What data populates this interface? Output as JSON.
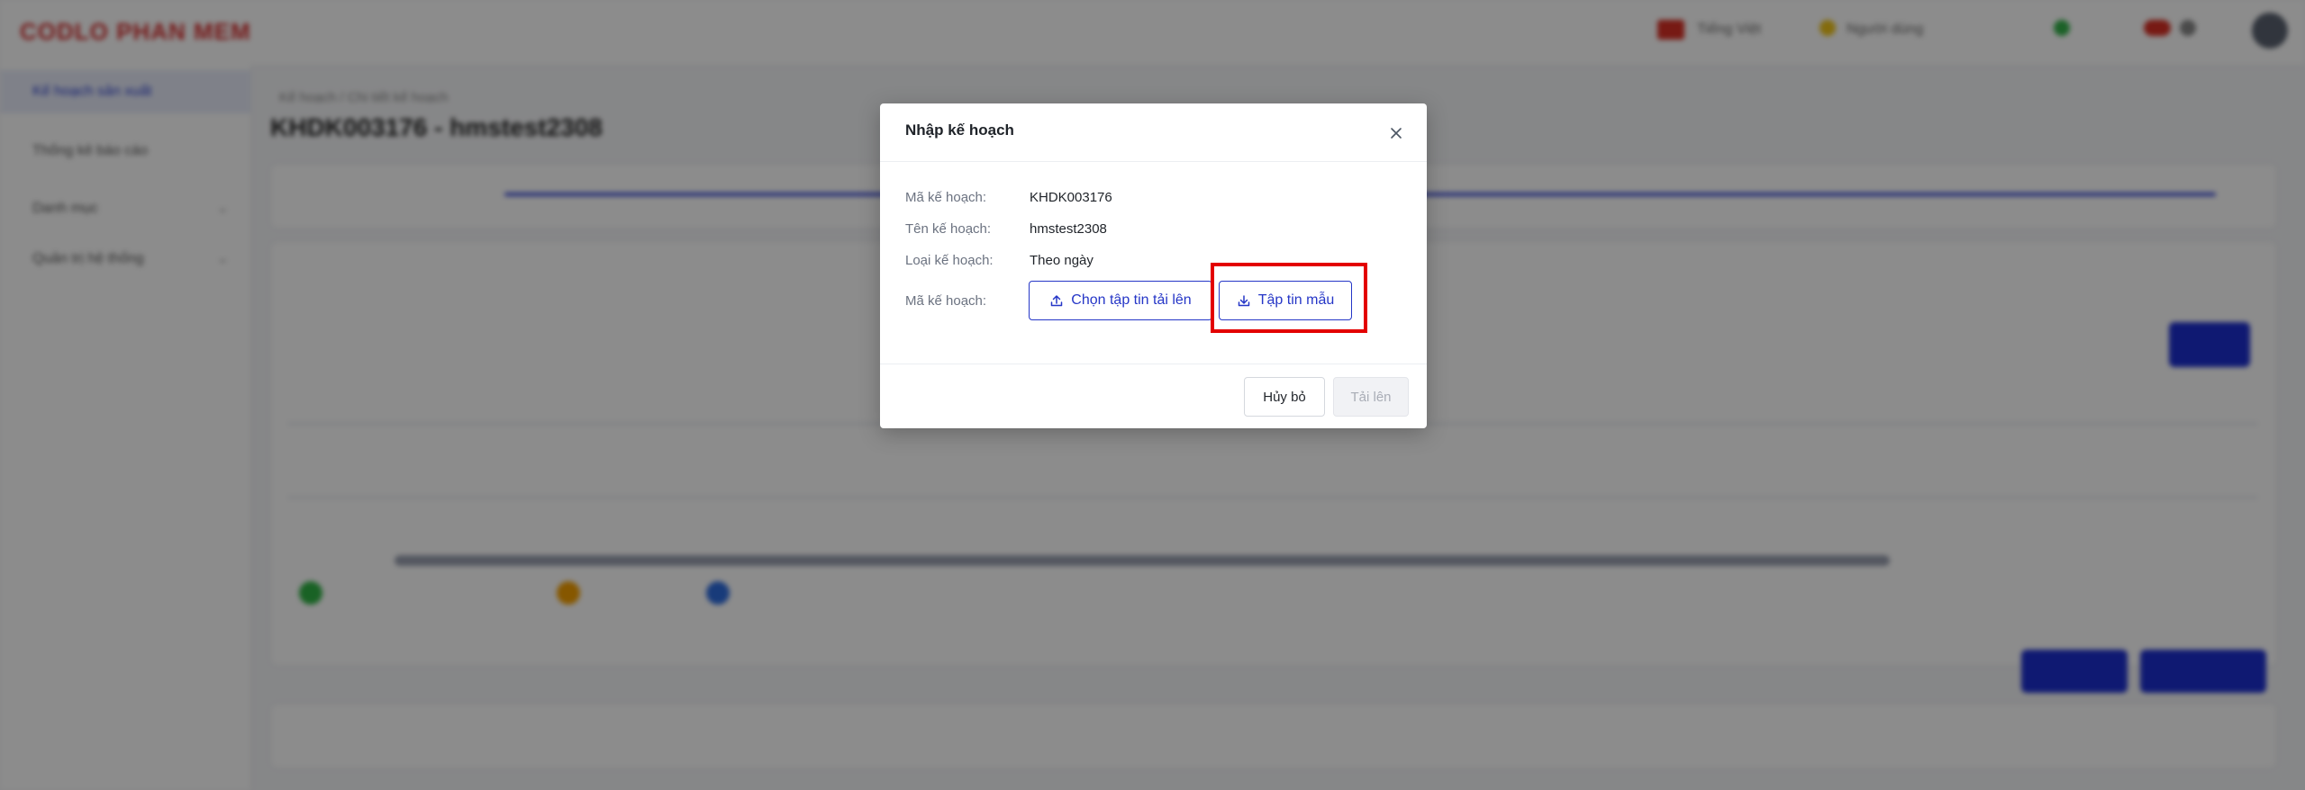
{
  "background": {
    "logo": "CODLO PHAN MEM",
    "sidebar": {
      "items": [
        {
          "label": "Kế hoạch sản xuất"
        },
        {
          "label": "Thống kê báo cáo"
        },
        {
          "label": "Danh mục"
        },
        {
          "label": "Quản trị hệ thống"
        }
      ]
    },
    "breadcrumb": "Kế hoạch / Chi tiết kế hoạch",
    "page_title": "KHDK003176 - hmstest2308",
    "topbar": {
      "language": "Tiếng Việt",
      "user": "Người dùng"
    }
  },
  "modal": {
    "title": "Nhập kế hoạch",
    "close_label": "×",
    "fields": [
      {
        "label": "Mã kế hoạch:",
        "value": "KHDK003176"
      },
      {
        "label": "Tên kế hoạch:",
        "value": "hmstest2308"
      },
      {
        "label": "Loại kế hoạch:",
        "value": "Theo ngày"
      }
    ],
    "file_row_label": "Mã kế hoạch:",
    "choose_file_label": "Chọn tập tin tải lên",
    "template_file_label": "Tập tin mẫu",
    "cancel_label": "Hủy bỏ",
    "upload_label": "Tải lên"
  },
  "colors": {
    "primary": "#2536c7",
    "highlight": "#e30000",
    "overlay": "rgba(0,0,0,0.45)"
  },
  "icons": {
    "upload": "upload-icon",
    "download": "download-icon",
    "close": "close-icon"
  }
}
